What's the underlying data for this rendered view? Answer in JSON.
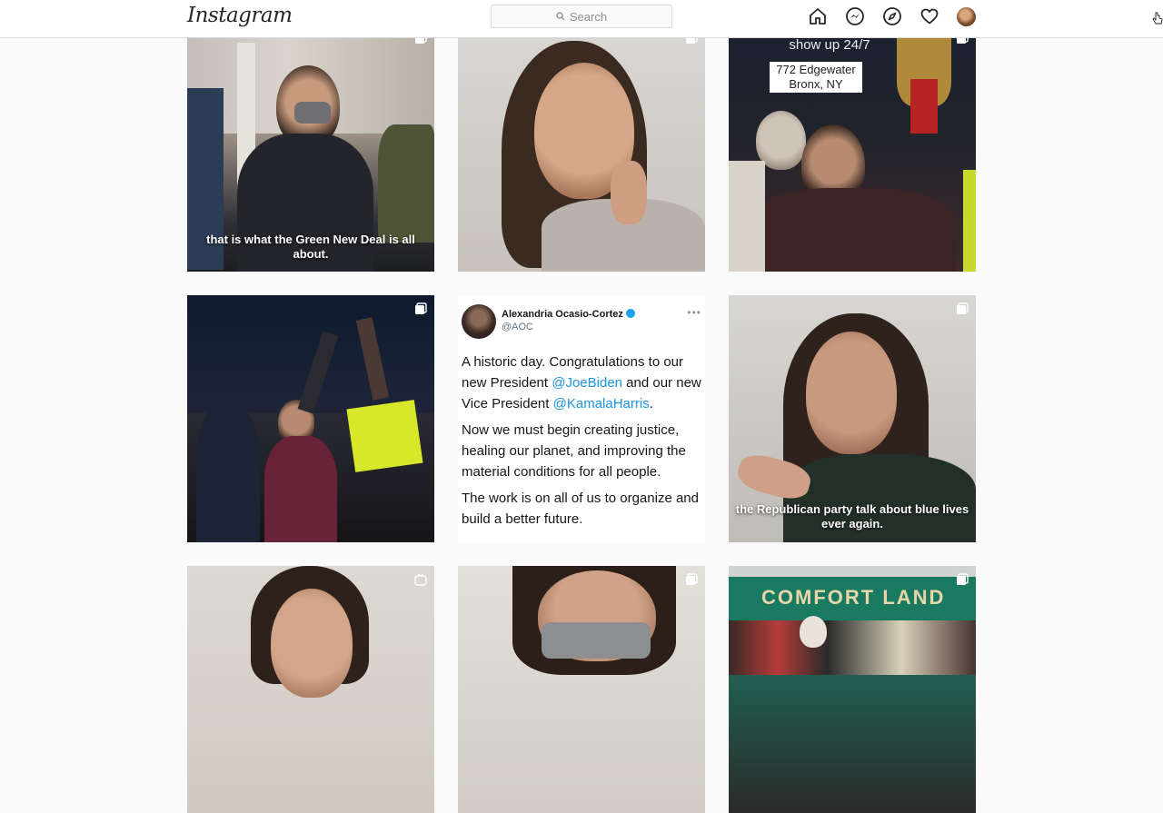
{
  "app": {
    "title": "Instagram"
  },
  "header": {
    "logo": "Instagram",
    "search_placeholder": "Search",
    "icons": [
      "home-icon",
      "messenger-icon",
      "explore-icon",
      "activity-heart-icon",
      "profile-avatar"
    ]
  },
  "grid": {
    "tiles": [
      {
        "caption": "that is what the Green New Deal is all about.",
        "icon": "carousel-icon"
      },
      {
        "caption": "",
        "icon": "carousel-icon"
      },
      {
        "sign_top": "show up 24/7",
        "sign_line1": "772 Edgewater",
        "sign_line2": "Bronx, NY",
        "icon": "carousel-icon"
      },
      {
        "caption": "",
        "icon": "carousel-icon"
      },
      {
        "tweet": {
          "name": "Alexandria Ocasio-Cortez",
          "handle": "@AOC",
          "p1_a": "A historic day. Congratulations to our new President ",
          "p1_link1": "@JoeBiden",
          "p1_b": " and our new Vice President ",
          "p1_link2": "@KamalaHarris",
          "p1_c": ".",
          "p2": "Now we must begin creating justice, healing our planet, and improving the material conditions for all people.",
          "p3": "The work is on all of us to organize and build a better future."
        }
      },
      {
        "caption": "the Republican party talk about blue lives ever again.",
        "icon": "carousel-icon"
      },
      {
        "caption": "",
        "icon": "igtv-icon"
      },
      {
        "caption": "",
        "icon": "carousel-icon"
      },
      {
        "store_sign": "COMFORT LAND",
        "icon": "carousel-icon"
      }
    ]
  },
  "colors": {
    "accent_link": "#1b95e0",
    "verified": "#1da1f2",
    "border": "#dbdbdb",
    "background": "#fafafa"
  }
}
